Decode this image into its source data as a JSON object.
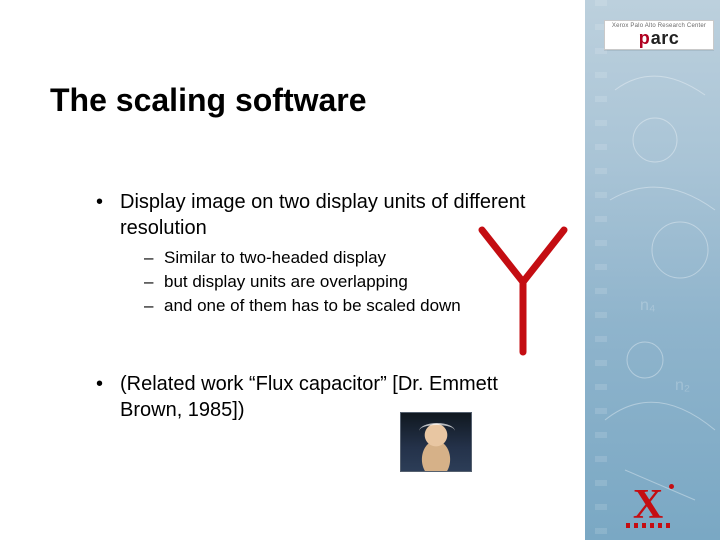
{
  "title": "The scaling software",
  "bullets": {
    "b1": "Display image on two display units of different resolution",
    "subs": {
      "s1": "Similar to two-headed display",
      "s2": "but display units are overlapping",
      "s3": "and one of them has to be scaled down"
    },
    "b2": "(Related work “Flux capacitor” [Dr. Emmett Brown, 1985])"
  },
  "branding": {
    "parc_subtitle": "Xerox Palo Alto Research Center",
    "parc_p": "p",
    "parc_arc": "arc",
    "x_glyph": "X"
  }
}
